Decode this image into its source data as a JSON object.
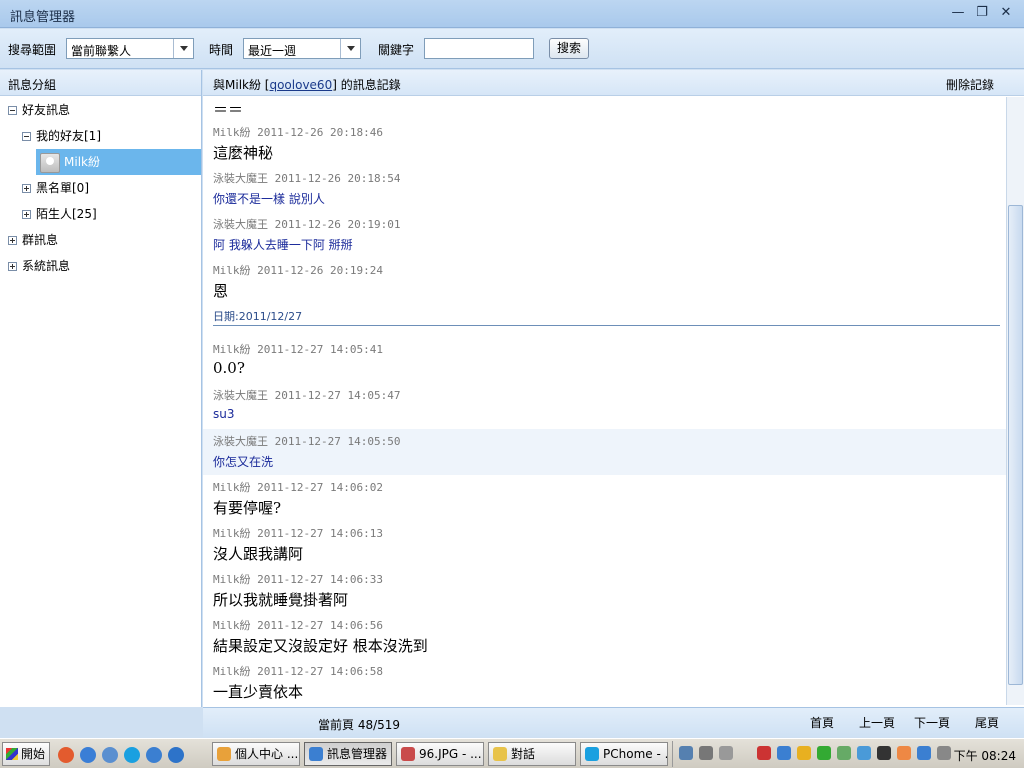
{
  "window": {
    "title": "訊息管理器"
  },
  "search": {
    "scope_label": "搜尋範圍",
    "scope_value": "當前聯繫人",
    "time_label": "時間",
    "time_value": "最近一週",
    "keyword_label": "關鍵字",
    "keyword_value": "",
    "search_button": "搜索"
  },
  "sidebar": {
    "header": "訊息分組",
    "nodes": [
      {
        "label": "好友訊息",
        "expanded": true
      },
      {
        "label": "我的好友[1]",
        "expanded": true
      },
      {
        "label": "Milk紛",
        "selected": true
      },
      {
        "label": "黑名單[0]",
        "expanded": false
      },
      {
        "label": "陌生人[25]",
        "expanded": false
      },
      {
        "label": "群訊息",
        "expanded": false
      },
      {
        "label": "系統訊息",
        "expanded": false
      }
    ]
  },
  "conversation": {
    "title_prefix": "與Milk紛 [",
    "contact_id": "qoolove60",
    "title_suffix": "] 的訊息記錄",
    "delete_label": "刪除記錄",
    "top_fragment": "＝＝",
    "date_separator": "日期:2011/12/27",
    "messages": [
      {
        "meta": "Milk紛 2011-12-26 20:18:46",
        "text": "這麼神秘",
        "style": "normal"
      },
      {
        "meta": "泳裝大魔王 2011-12-26 20:18:54",
        "text": "你還不是一樣 說別人",
        "style": "blue"
      },
      {
        "meta": "泳裝大魔王 2011-12-26 20:19:01",
        "text": "阿 我躲人去睡一下阿 掰掰",
        "style": "blue"
      },
      {
        "meta": "Milk紛 2011-12-26 20:19:24",
        "text": "恩",
        "style": "normal"
      },
      {
        "meta": "Milk紛 2011-12-27 14:05:41",
        "text": "0.0?",
        "style": "normal"
      },
      {
        "meta": "泳裝大魔王 2011-12-27 14:05:47",
        "text": "su3",
        "style": "blue"
      },
      {
        "meta": "泳裝大魔王 2011-12-27 14:05:50",
        "text": "你怎又在洗",
        "style": "blue"
      },
      {
        "meta": "Milk紛 2011-12-27 14:06:02",
        "text": "有要停喔?",
        "style": "normal"
      },
      {
        "meta": "Milk紛 2011-12-27 14:06:13",
        "text": "沒人跟我講阿",
        "style": "normal"
      },
      {
        "meta": "Milk紛 2011-12-27 14:06:33",
        "text": "所以我就睡覺掛著阿",
        "style": "normal"
      },
      {
        "meta": "Milk紛 2011-12-27 14:06:56",
        "text": "結果設定又沒設定好 根本沒洗到",
        "style": "normal"
      },
      {
        "meta": "Milk紛 2011-12-27 14:06:58",
        "text": "一直少賣依本",
        "style": "normal"
      }
    ]
  },
  "footer": {
    "page_info": "當前頁 48/519",
    "first": "首頁",
    "prev": "上一頁",
    "next": "下一頁",
    "last": "尾頁"
  },
  "taskbar": {
    "start": "開始",
    "tasks": [
      {
        "label": "個人中心 ...",
        "color": "#e8a13a"
      },
      {
        "label": "訊息管理器",
        "color": "#3b7fd1",
        "active": true
      },
      {
        "label": "96.JPG - ...",
        "color": "#c94b4b"
      },
      {
        "label": "對話",
        "color": "#e8c34a"
      },
      {
        "label": "PChome - ...",
        "color": "#1aa0e0"
      }
    ],
    "clock": "下午 08:24"
  }
}
